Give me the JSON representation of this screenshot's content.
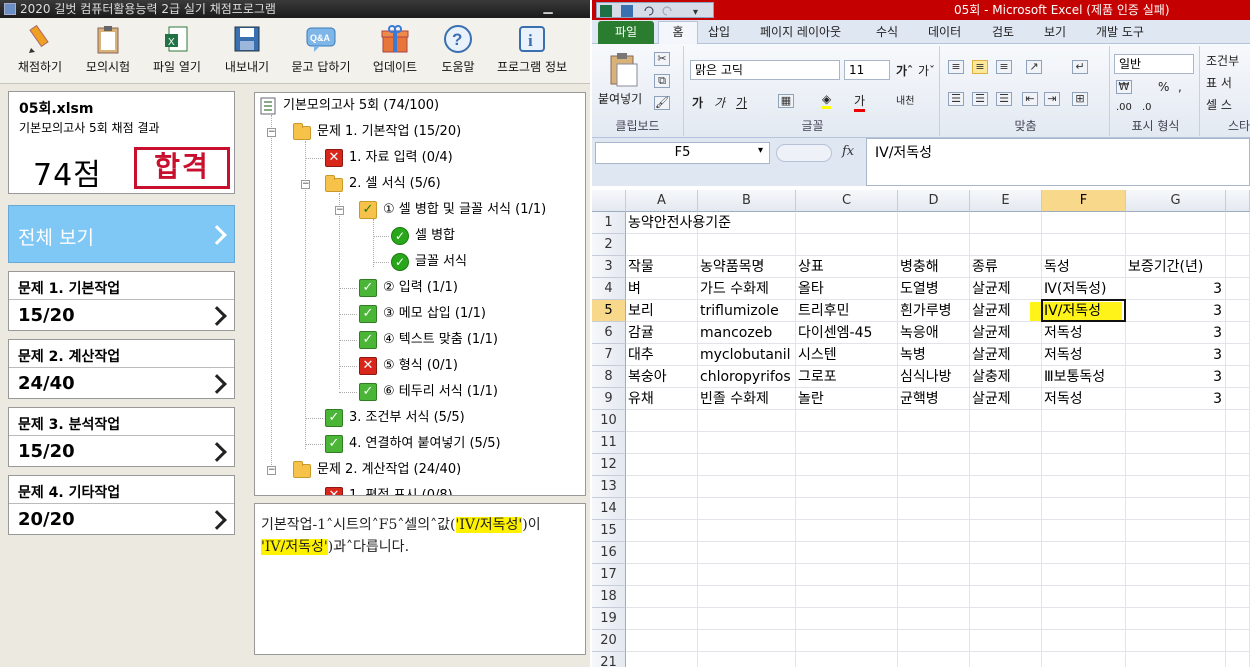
{
  "grader": {
    "title": "2020 길벗 컴퓨터활용능력 2급 실기 채점프로그램",
    "toolbar": [
      "채점하기",
      "모의시험",
      "파일 열기",
      "내보내기",
      "묻고 답하기",
      "업데이트",
      "도움말",
      "프로그램 정보"
    ],
    "file": {
      "name": "05회.xlsm",
      "subtitle": "기본모의고사 5회 채점 결과",
      "score": "74점",
      "result": "합격"
    },
    "view_all": "전체 보기",
    "sections": [
      {
        "title": "문제 1. 기본작업",
        "score": "15/20"
      },
      {
        "title": "문제 2. 계산작업",
        "score": "24/40"
      },
      {
        "title": "문제 3. 분석작업",
        "score": "15/20"
      },
      {
        "title": "문제 4. 기타작업",
        "score": "20/20"
      }
    ],
    "tree": {
      "root": "기본모의고사 5회 (74/100)",
      "s1": "문제 1. 기본작업 (15/20)",
      "s1_1": "1. 자료 입력 (0/4)",
      "s1_2": "2. 셀 서식 (5/6)",
      "s1_2_1": "① 셀 병합 및 글꼴 서식 (1/1)",
      "s1_2_1a": "셀 병합",
      "s1_2_1b": "글꼴 서식",
      "s1_2_2": "② 입력 (1/1)",
      "s1_2_3": "③ 메모 삽입 (1/1)",
      "s1_2_4": "④ 텍스트 맞춤 (1/1)",
      "s1_2_5": "⑤ 형식 (0/1)",
      "s1_2_6": "⑥ 테두리 서식 (1/1)",
      "s1_3": "3. 조건부 서식 (5/5)",
      "s1_4": "4. 연결하여 붙여넣기 (5/5)",
      "s2": "문제 2. 계산작업 (24/40)",
      "s2_1": "1. 평점 표시 (0/8)"
    },
    "message": {
      "p1": "기본작업-1˄시트의˄F5˄셀의˄값(",
      "h1": "'IV/저독성'",
      "p2": ")이 ",
      "h2": "'IV/저독성'",
      "p3": ")과˄다릅니다."
    }
  },
  "excel": {
    "title": "05회  -  Microsoft Excel (제품 인증 실패)",
    "tabs": [
      "파일",
      "홈",
      "삽입",
      "페이지 레이아웃",
      "수식",
      "데이터",
      "검토",
      "보기",
      "개발 도구"
    ],
    "ribbon": {
      "paste": "붙여넣기",
      "clipboard": "클립보드",
      "font_name": "맑은 고딕",
      "font_size": "11",
      "font_group": "글꼴",
      "align_group": "맞춤",
      "number_format": "일반",
      "number_group": "표시 형식",
      "styles_group": "스타",
      "cond1": "조건부",
      "cond2": "표 서",
      "cond3": "셀 스"
    },
    "name_box": "F5",
    "formula": "IV/저독성",
    "columns": [
      "A",
      "B",
      "C",
      "D",
      "E",
      "F",
      "G"
    ],
    "rows": [
      [
        "농약안전사용기준",
        "",
        "",
        "",
        "",
        "",
        ""
      ],
      [
        "",
        "",
        "",
        "",
        "",
        "",
        ""
      ],
      [
        "작물",
        "농약품목명",
        "상표",
        "병충해",
        "종류",
        "독성",
        "보증기간(년)"
      ],
      [
        "벼",
        "가드 수화제",
        "올타",
        "도열병",
        "살균제",
        "Ⅳ(저독성)",
        "3"
      ],
      [
        "보리",
        "triflumizole",
        "트리후민",
        "흰가루병",
        "살균제",
        "IV/저독성",
        "3"
      ],
      [
        "감귤",
        "mancozeb",
        "다이센엠-45",
        "녹응애",
        "살균제",
        "저독성",
        "3"
      ],
      [
        "대추",
        "myclobutanil",
        "시스텐",
        "녹병",
        "살균제",
        "저독성",
        "3"
      ],
      [
        "복숭아",
        "chloropyrifos",
        "그로포",
        "심식나방",
        "살충제",
        "Ⅲ보통독성",
        "3"
      ],
      [
        "유채",
        "빈졸 수화제",
        "놀란",
        "균핵병",
        "살균제",
        "저독성",
        "3"
      ],
      [
        "",
        "",
        "",
        "",
        "",
        "",
        ""
      ],
      [
        "",
        "",
        "",
        "",
        "",
        "",
        ""
      ],
      [
        "",
        "",
        "",
        "",
        "",
        "",
        ""
      ],
      [
        "",
        "",
        "",
        "",
        "",
        "",
        ""
      ],
      [
        "",
        "",
        "",
        "",
        "",
        "",
        ""
      ],
      [
        "",
        "",
        "",
        "",
        "",
        "",
        ""
      ],
      [
        "",
        "",
        "",
        "",
        "",
        "",
        ""
      ],
      [
        "",
        "",
        "",
        "",
        "",
        "",
        ""
      ],
      [
        "",
        "",
        "",
        "",
        "",
        "",
        ""
      ],
      [
        "",
        "",
        "",
        "",
        "",
        "",
        ""
      ],
      [
        "",
        "",
        "",
        "",
        "",
        "",
        ""
      ],
      [
        "",
        "",
        "",
        "",
        "",
        "",
        ""
      ]
    ],
    "active_cell": "F5"
  }
}
